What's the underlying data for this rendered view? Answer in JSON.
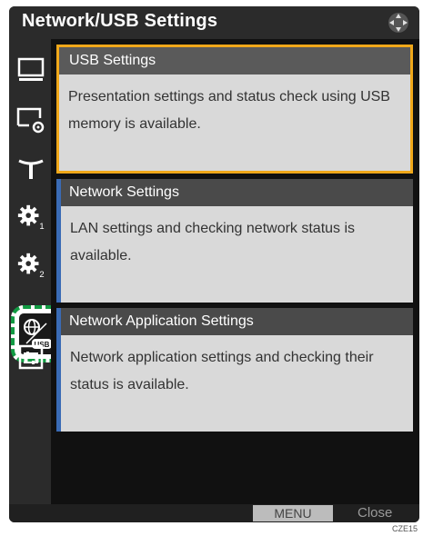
{
  "window": {
    "title": "Network/USB Settings"
  },
  "sidebar": {
    "items": [
      {
        "icon": "monitor-icon"
      },
      {
        "icon": "display-settings-icon"
      },
      {
        "icon": "antenna-icon"
      },
      {
        "icon": "gear-1-icon",
        "sub": "1"
      },
      {
        "icon": "gear-2-icon",
        "sub": "2"
      },
      {
        "icon": "network-usb-icon",
        "selected": true,
        "badge": "USB"
      },
      {
        "icon": "status-list-icon"
      }
    ]
  },
  "cards": [
    {
      "title": "USB Settings",
      "description": "Presentation settings and status check using USB memory is available.",
      "selected": true
    },
    {
      "title": "Network Settings",
      "description": "LAN settings and checking network status is available.",
      "selected": false
    },
    {
      "title": "Network Application Settings",
      "description": "Network application settings and checking their status is available.",
      "selected": false
    }
  ],
  "footer": {
    "menu_label": "MENU",
    "close_label": "Close"
  },
  "figure_code": "CZE15",
  "colors": {
    "selected_border": "#f0a81a",
    "card_accent": "#3a6bb5",
    "highlight_dashed": "#129b43"
  }
}
